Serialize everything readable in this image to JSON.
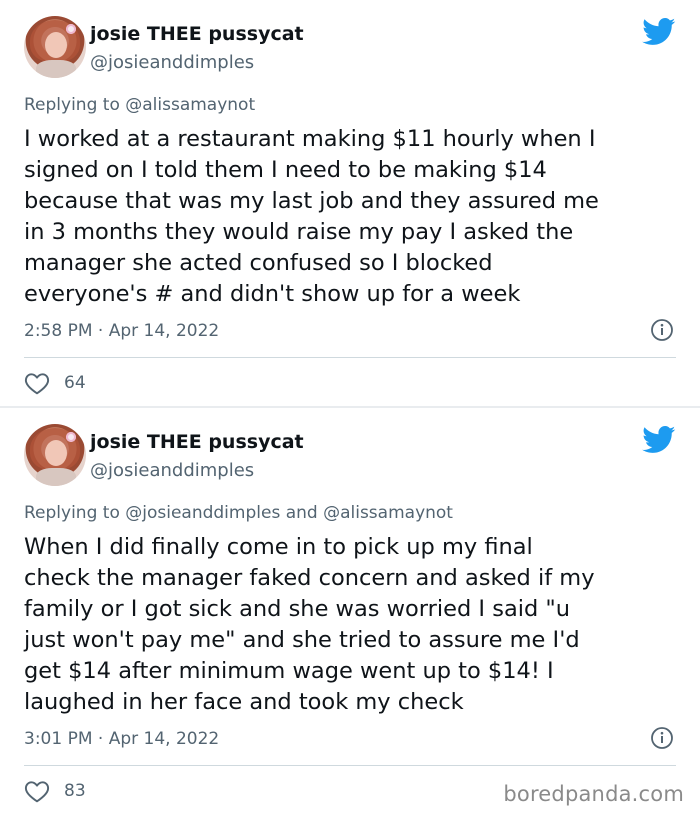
{
  "tweets": [
    {
      "author_name": "josie THEE pussycat",
      "author_handle": "@josieanddimples",
      "replying_prefix": "Replying to ",
      "replying_mentions": "@alissamaynot",
      "body_lines": [
        "I worked at a restaurant making $11 hourly when I",
        "signed on I told them I need to be making $14",
        "because that was my last job and they assured me",
        "in 3 months they would raise my pay I asked the",
        "manager she acted confused so I blocked",
        "everyone's # and didn't show up for a week"
      ],
      "timestamp": "2:58 PM · Apr 14, 2022",
      "like_count": "64"
    },
    {
      "author_name": "josie THEE pussycat",
      "author_handle": "@josieanddimples",
      "replying_prefix": "Replying to ",
      "replying_mentions": "@josieanddimples and @alissamaynot",
      "body_lines": [
        "When I did finally come in to pick up my final",
        "check the manager faked concern and asked if my",
        "family or I got sick and she was worried I said \"u",
        "just won't pay me\" and she tried to assure me I'd",
        "get $14 after minimum wage went up to $14! I",
        "laughed in her face and took my check"
      ],
      "timestamp": "3:01 PM · Apr 14, 2022",
      "like_count": "83"
    }
  ],
  "watermark": "boredpanda.com",
  "icons": {
    "brand": "twitter-bird-icon",
    "info": "info-icon",
    "like": "heart-icon"
  },
  "colors": {
    "twitter_blue": "#1d9bf0",
    "secondary_text": "#536471",
    "primary_text": "#0f1419"
  }
}
